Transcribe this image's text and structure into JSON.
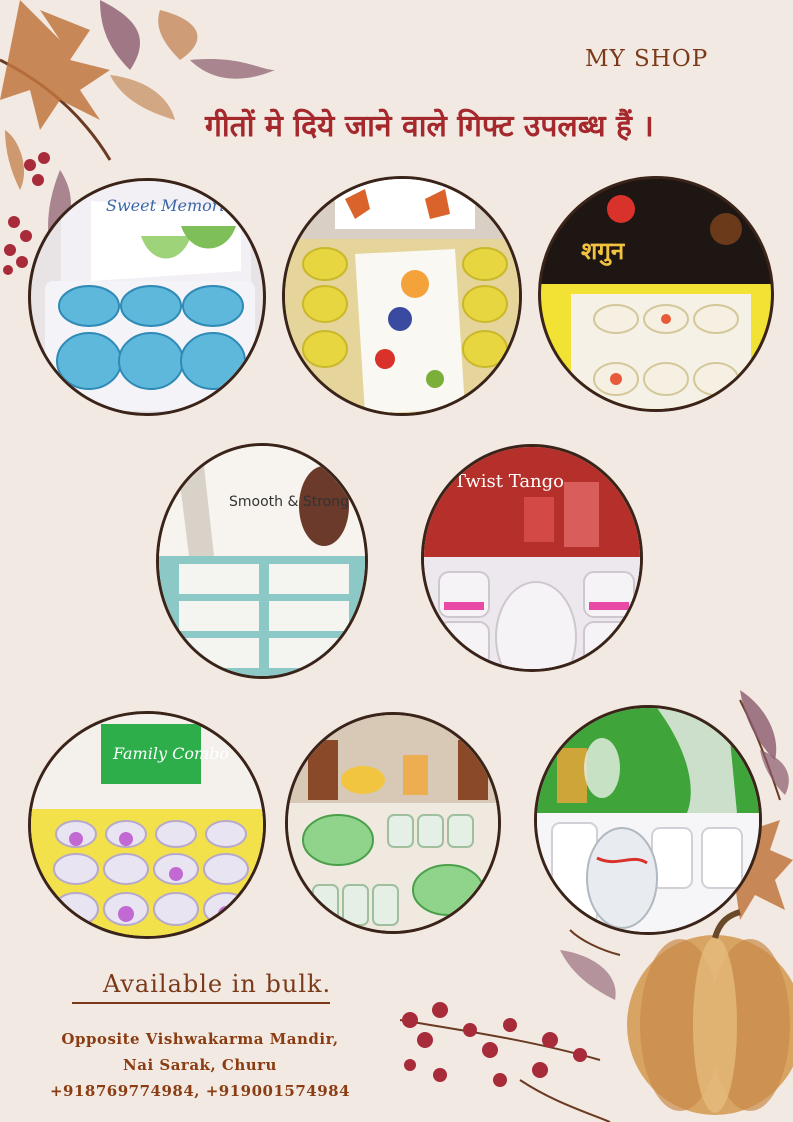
{
  "header": {
    "shop_name": "MY SHOP",
    "headline": "गीतों मे दिये जाने वाले गिफ्ट उपलब्ध हैं ।"
  },
  "products": [
    {
      "box_text": "Sweet Memories",
      "icon": "glass-bowl-set-photo"
    },
    {
      "box_text": "",
      "icon": "fruit-bowl-tray-photo"
    },
    {
      "box_text": "शगुन",
      "icon": "shagun-bowl-set-photo"
    },
    {
      "box_text": "Smooth & Strong",
      "icon": "tumbler-set-photo"
    },
    {
      "box_text": "Twist Tango",
      "icon": "jug-glass-set-photo"
    },
    {
      "box_text": "Family Combo",
      "icon": "family-combo-bowls-photo"
    },
    {
      "box_text": "",
      "icon": "bowl-glass-combo-photo"
    },
    {
      "box_text": "",
      "icon": "jug-tumbler-set-photo"
    }
  ],
  "footer": {
    "bulk_text": "Available in bulk.",
    "address_line1": "Opposite Vishwakarma Mandir,",
    "address_line2": "Nai Sarak, Churu",
    "phones": "+918769774984, +919001574984"
  },
  "colors": {
    "background": "#f2e9e2",
    "headline": "#a5282d",
    "accent_brown": "#7a3a1a"
  }
}
